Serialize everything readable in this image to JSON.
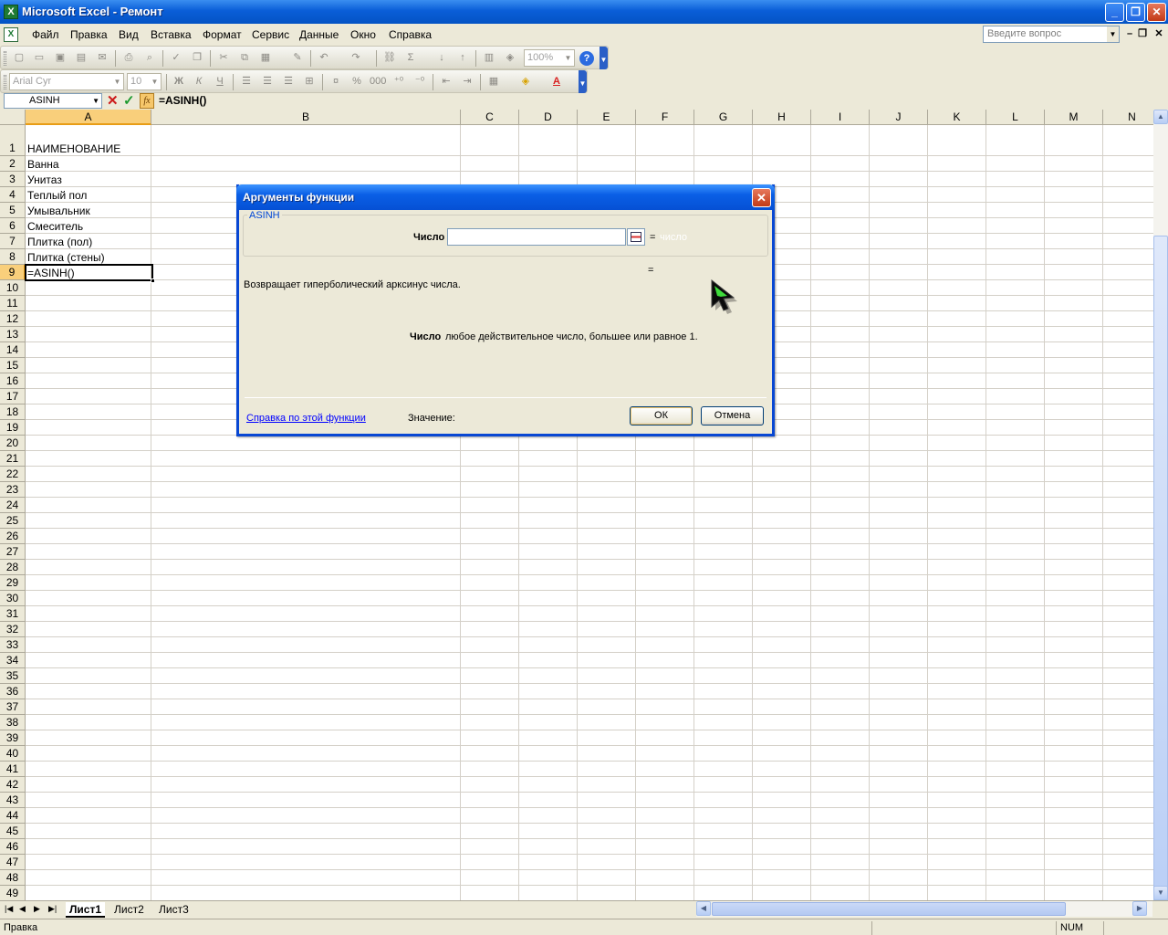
{
  "window": {
    "title": "Microsoft Excel - Ремонт",
    "app_icon_glyph": "X",
    "controls": {
      "minimize": "_",
      "maximize": "❐",
      "close": "✕"
    }
  },
  "menu": {
    "items": [
      "Файл",
      "Правка",
      "Вид",
      "Вставка",
      "Формат",
      "Сервис",
      "Данные",
      "Окно",
      "Справка"
    ],
    "help_placeholder": "Введите вопрос",
    "doc_controls": {
      "minimize": "–",
      "restore": "❐",
      "close": "✕"
    }
  },
  "toolbar_standard": {
    "zoom": "100%",
    "icons": [
      "new-icon",
      "open-icon",
      "save-icon",
      "permission-icon",
      "email-icon",
      "print-icon",
      "print-preview-icon",
      "spelling-icon",
      "research-icon",
      "cut-icon",
      "copy-icon",
      "paste-icon",
      "format-painter-icon",
      "undo-icon",
      "redo-icon",
      "hyperlink-icon",
      "autosum-icon",
      "sort-ascending-icon",
      "sort-descending-icon",
      "chart-wizard-icon",
      "drawing-icon",
      "help-icon"
    ]
  },
  "toolbar_formatting": {
    "font_name": "Arial Cyr",
    "font_size": "10",
    "bold": "Ж",
    "italic": "К",
    "underline": "Ч",
    "icons": [
      "align-left-icon",
      "align-center-icon",
      "align-right-icon",
      "merge-center-icon",
      "currency-icon",
      "percent-icon",
      "thousands-icon",
      "increase-decimal-icon",
      "decrease-decimal-icon",
      "decrease-indent-icon",
      "increase-indent-icon",
      "borders-icon",
      "fill-color-icon",
      "font-color-icon"
    ]
  },
  "formula_bar": {
    "name_box": "ASINH",
    "cancel": "✕",
    "enter": "✓",
    "fx": "fx",
    "content": "=ASINH()"
  },
  "grid": {
    "columns": [
      "A",
      "B",
      "C",
      "D",
      "E",
      "F",
      "G",
      "H",
      "I",
      "J",
      "K",
      "L",
      "M",
      "N"
    ],
    "selected_column": "A",
    "selected_row": 9,
    "row_numbers": [
      "1",
      "2",
      "3",
      "4",
      "5",
      "6",
      "7",
      "8",
      "9",
      "10",
      "11",
      "12",
      "13",
      "14",
      "15",
      "16",
      "17",
      "18",
      "19",
      "20",
      "21",
      "22",
      "23",
      "24",
      "25",
      "26",
      "27",
      "28",
      "29",
      "30",
      "31",
      "32",
      "33",
      "34",
      "35",
      "36",
      "37",
      "38",
      "39",
      "40",
      "41",
      "42",
      "43",
      "44",
      "45",
      "46",
      "47",
      "48",
      "49"
    ],
    "cells_A": [
      "НАИМЕНОВАНИЕ",
      "Ванна",
      "Унитаз",
      "Теплый пол",
      "Умывальник",
      "Смеситель",
      "Плитка (пол)",
      "Плитка (стены)",
      "=ASINH()"
    ]
  },
  "sheets": {
    "tabs": [
      "Лист1",
      "Лист2",
      "Лист3"
    ],
    "active": "Лист1",
    "nav": [
      "|◀",
      "◀",
      "▶",
      "▶|"
    ]
  },
  "status": {
    "text": "Правка",
    "num": "NUM"
  },
  "dialog": {
    "title": "Аргументы функции",
    "close": "✕",
    "function_name": "ASINH",
    "arg_label": "Число",
    "arg_value": "",
    "arg_eq": "=",
    "arg_type": "число",
    "result_eq": "=",
    "description": "Возвращает гиперболический арксинус числа.",
    "arg_help_name": "Число",
    "arg_help_text": "любое действительное число, большее или равное 1.",
    "help_link": "Справка по этой функции",
    "value_label": "Значение:",
    "ok": "ОК",
    "cancel": "Отмена"
  }
}
